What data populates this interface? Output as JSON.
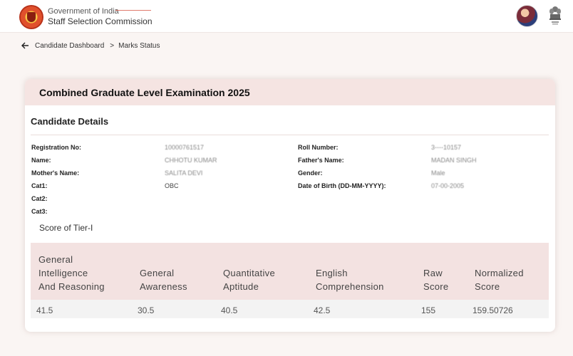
{
  "header": {
    "org_line1": "Government of India",
    "org_line2": "Staff Selection Commission",
    "logo_icon": "ssc-logo-icon",
    "emblem_icon": "national-emblem-icon",
    "avatar_icon": "user-avatar-icon"
  },
  "breadcrumb": {
    "parent": "Candidate Dashboard",
    "separator": ">",
    "current": "Marks Status"
  },
  "card": {
    "exam_title": "Combined Graduate Level Examination 2025",
    "section_title": "Candidate Details",
    "details_left": [
      {
        "label": "Registration No:",
        "value": "10000761517"
      },
      {
        "label": "Name:",
        "value": "CHHOTU KUMAR"
      },
      {
        "label": "Mother's Name:",
        "value": "SALITA DEVI"
      },
      {
        "label": "Cat1:",
        "value": "OBC"
      },
      {
        "label": "Cat2:",
        "value": ""
      },
      {
        "label": "Cat3:",
        "value": ""
      }
    ],
    "details_right": [
      {
        "label": "Roll Number:",
        "value": "3----10157"
      },
      {
        "label": "Father's Name:",
        "value": "MADAN SINGH"
      },
      {
        "label": "Gender:",
        "value": "Male"
      },
      {
        "label": "Date of Birth (DD-MM-YYYY):",
        "value": "07-00-2005"
      }
    ],
    "tier_title": "Score of Tier-I",
    "score_columns": [
      [
        "General",
        "Intelligence",
        "And Reasoning"
      ],
      [
        "General",
        "Awareness"
      ],
      [
        "Quantitative",
        "Aptitude"
      ],
      [
        "English",
        "Comprehension"
      ],
      [
        "Raw",
        "Score"
      ],
      [
        "Normalized",
        "Score"
      ]
    ],
    "score_values": [
      "41.5",
      "30.5",
      "40.5",
      "42.5",
      "155",
      "159.50726"
    ]
  }
}
